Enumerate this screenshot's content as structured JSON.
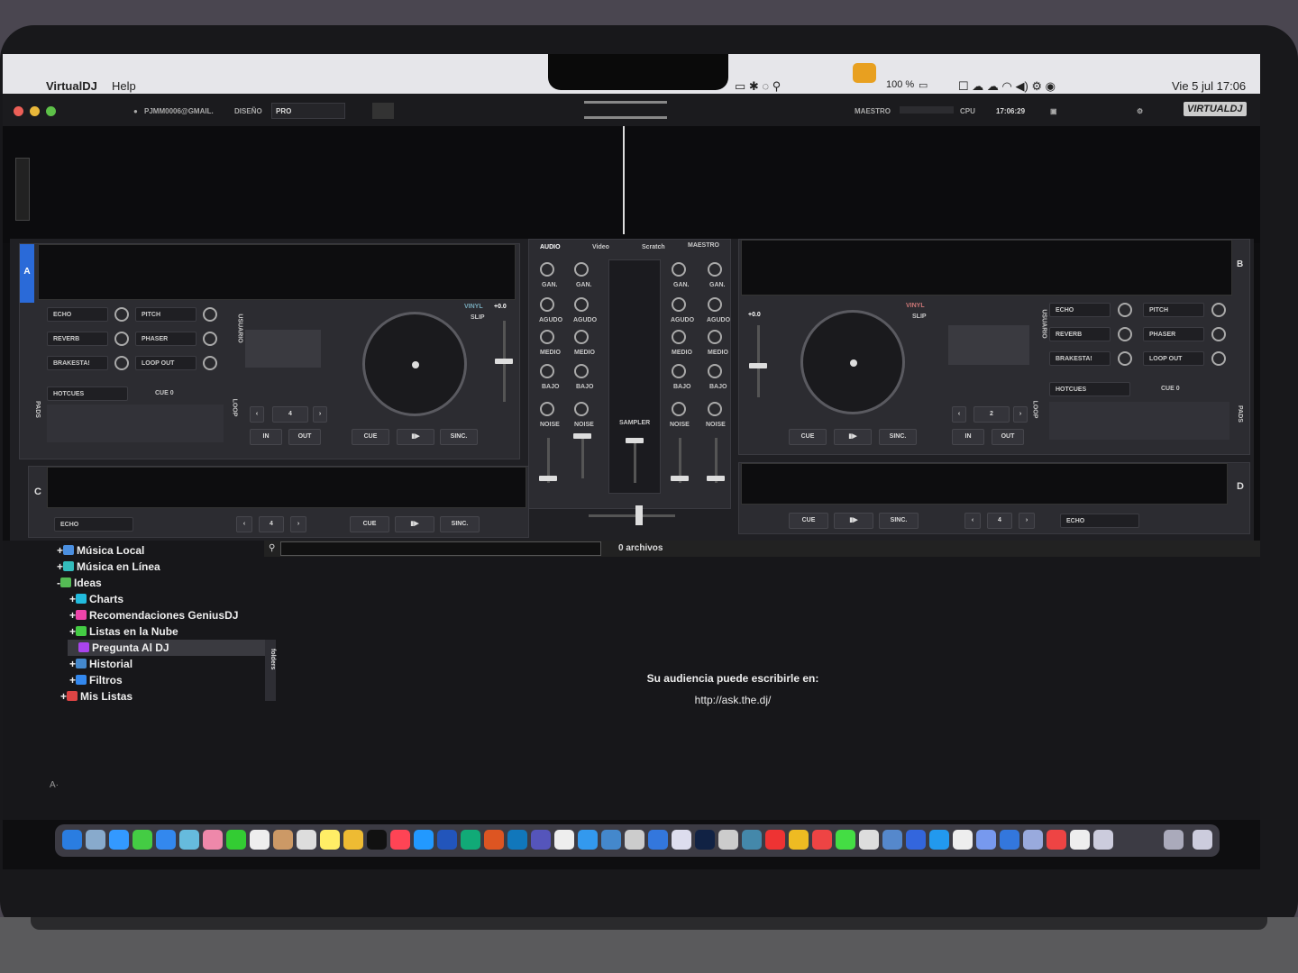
{
  "menubar": {
    "app_name": "VirtualDJ",
    "help": "Help",
    "battery": "100 %",
    "clock": "Vie 5 jul  17:06"
  },
  "titlebar": {
    "user": "PJMM0006@GMAIL.",
    "design_label": "DISEÑO",
    "design_value": "PRO",
    "master_label": "MAESTRO",
    "cpu_label": "CPU",
    "time": "17:06:29",
    "logo": "VIRTUALDJ"
  },
  "mixer": {
    "tabs": [
      "AUDIO",
      "Video",
      "Scratch",
      "MAESTRO"
    ],
    "gain": "GAN.",
    "high": "AGUDO",
    "mid": "MEDIO",
    "low": "BAJO",
    "noise": "NOISE",
    "sampler": "SAMPLER"
  },
  "deck_a": {
    "letter": "A",
    "fx": [
      "ECHO",
      "REVERB",
      "BRAKESTA!",
      "PITCH",
      "PHASER",
      "LOOP OUT"
    ],
    "hotcues": "HOTCUES",
    "cue0": "CUE 0",
    "loop_size": "4",
    "in": "IN",
    "out": "OUT",
    "cue": "CUE",
    "sync": "SINC.",
    "pitch": "+0.0",
    "vinyl": "VINYL",
    "slip": "SLIP",
    "usuario": "USUARIO",
    "loop": "LOOP",
    "pads": "PADS"
  },
  "deck_b": {
    "letter": "B",
    "fx": [
      "ECHO",
      "REVERB",
      "BRAKESTA!",
      "PITCH",
      "PHASER",
      "LOOP OUT"
    ],
    "hotcues": "HOTCUES",
    "cue0": "CUE 0",
    "loop_size": "2",
    "in": "IN",
    "out": "OUT",
    "cue": "CUE",
    "sync": "SINC.",
    "pitch": "+0.0",
    "vinyl": "VINYL",
    "slip": "SLIP",
    "usuario": "USUARIO",
    "loop": "LOOP",
    "pads": "PADS"
  },
  "deck_c": {
    "letter": "C",
    "fx": "ECHO",
    "loop_size": "4",
    "cue": "CUE",
    "sync": "SINC."
  },
  "deck_d": {
    "letter": "D",
    "fx": "ECHO",
    "loop_size": "4",
    "cue": "CUE",
    "sync": "SINC."
  },
  "browser": {
    "tree": [
      "Música Local",
      "Música en Línea",
      "Ideas",
      "Charts",
      "Recomendaciones GeniusDJ",
      "Listas en la Nube",
      "Pregunta Al DJ",
      "Historial",
      "Filtros",
      "Mis Listas"
    ],
    "folders_tab": "folders",
    "file_count": "0 archivos",
    "message": "Su audiencia puede escribirle en:",
    "url": "http://ask.the.dj/"
  },
  "colors": {
    "accent": "#2a6ad8",
    "bg": "#202024",
    "panel": "#2c2c31"
  }
}
